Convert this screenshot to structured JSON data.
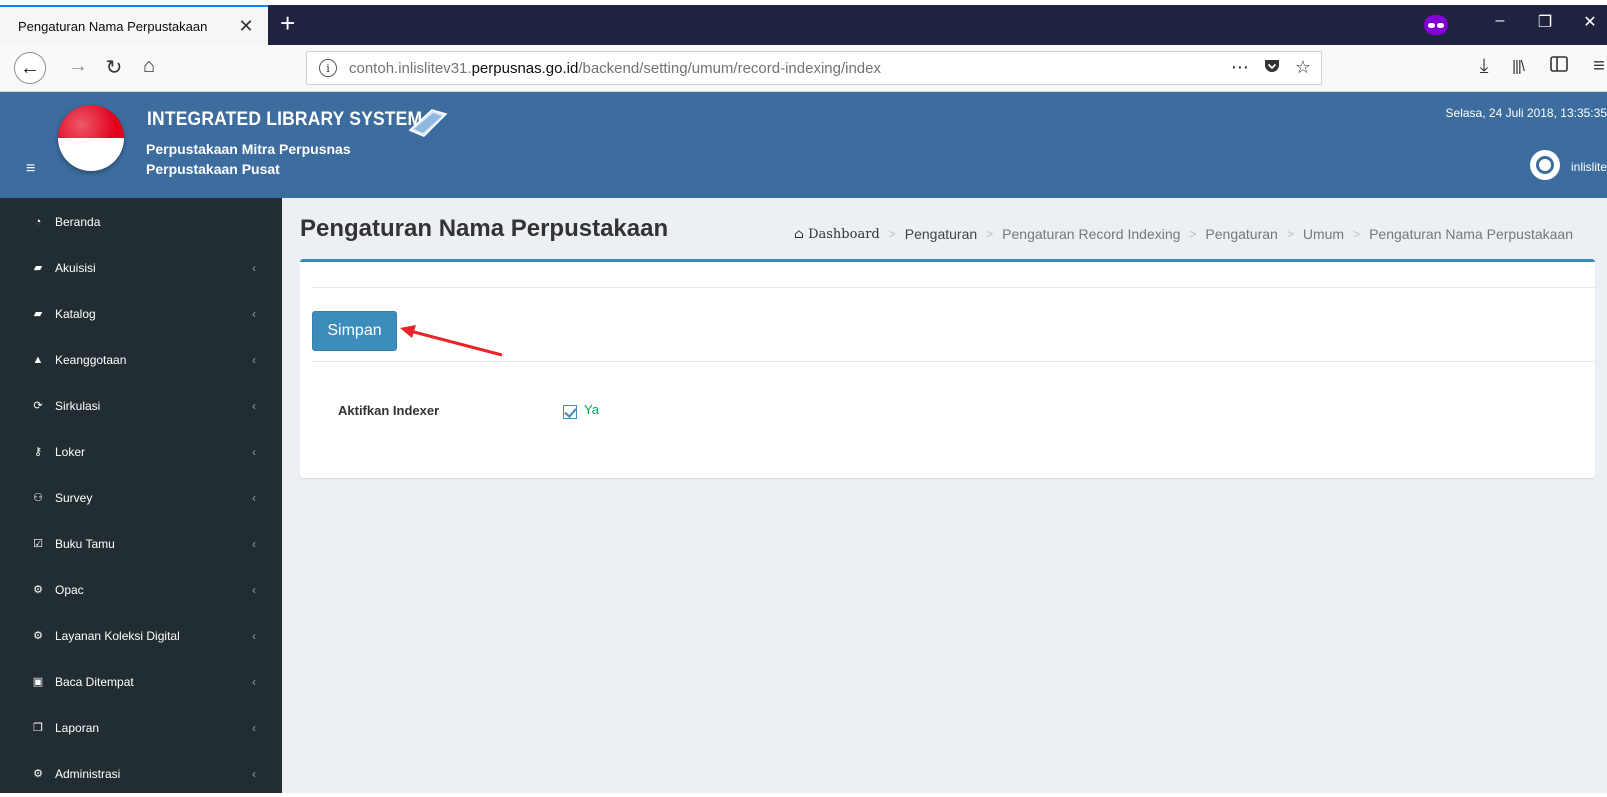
{
  "browser": {
    "tab_title": "Pengaturan Nama Perpustakaan",
    "tab_close": "✕",
    "new_tab": "+",
    "url_prefix": "contoh.inlislitev31.",
    "url_domain": "perpusnas.go.id",
    "url_path": "/backend/setting/umum/record-indexing/index",
    "private_icon": "private-browsing-mask-icon",
    "win_controls": [
      "–",
      "❐",
      "✕"
    ],
    "toolbar_icons": [
      "download-icon",
      "library-icon",
      "sidebar-icon",
      "menu-icon"
    ],
    "url_actions": [
      "page-actions-icon",
      "pocket-icon",
      "bookmark-star-icon"
    ]
  },
  "header": {
    "title": "INTEGRATED LIBRARY SYSTEM",
    "subtitle1": "Perpustakaan Mitra Perpusnas",
    "subtitle2": "Perpustakaan Pusat",
    "datetime": "Selasa, 24 Juli 2018, 13:35:35",
    "user": "inlislite",
    "colors": {
      "header_bg": "#3c6d9e",
      "sidebar_bg": "#222d32",
      "accent": "#3c8dbc"
    }
  },
  "sidebar": {
    "items": [
      {
        "label": "Beranda",
        "icon": "dashboard-icon",
        "submenu": false
      },
      {
        "label": "Akuisisi",
        "icon": "book-icon",
        "submenu": true
      },
      {
        "label": "Katalog",
        "icon": "book-icon",
        "submenu": true
      },
      {
        "label": "Keanggotaan",
        "icon": "user-icon",
        "submenu": true
      },
      {
        "label": "Sirkulasi",
        "icon": "refresh-icon",
        "submenu": true
      },
      {
        "label": "Loker",
        "icon": "key-icon",
        "submenu": true
      },
      {
        "label": "Survey",
        "icon": "users-icon",
        "submenu": true
      },
      {
        "label": "Buku Tamu",
        "icon": "check-square-icon",
        "submenu": true
      },
      {
        "label": "Opac",
        "icon": "cogs-icon",
        "submenu": true
      },
      {
        "label": "Layanan Koleksi Digital",
        "icon": "cogs-icon",
        "submenu": true
      },
      {
        "label": "Baca Ditempat",
        "icon": "feed-icon",
        "submenu": true
      },
      {
        "label": "Laporan",
        "icon": "copy-icon",
        "submenu": true
      },
      {
        "label": "Administrasi",
        "icon": "cogs-icon",
        "submenu": true
      }
    ]
  },
  "main": {
    "page_title": "Pengaturan Nama Perpustakaan",
    "breadcrumb": [
      "Dashboard",
      "Pengaturan",
      "Pengaturan Record Indexing",
      "Pengaturan",
      "Umum",
      "Pengaturan Nama Perpustakaan"
    ],
    "save_label": "Simpan",
    "field_label": "Aktifkan Indexer",
    "field_checked": true,
    "field_value_label": "Ya"
  }
}
